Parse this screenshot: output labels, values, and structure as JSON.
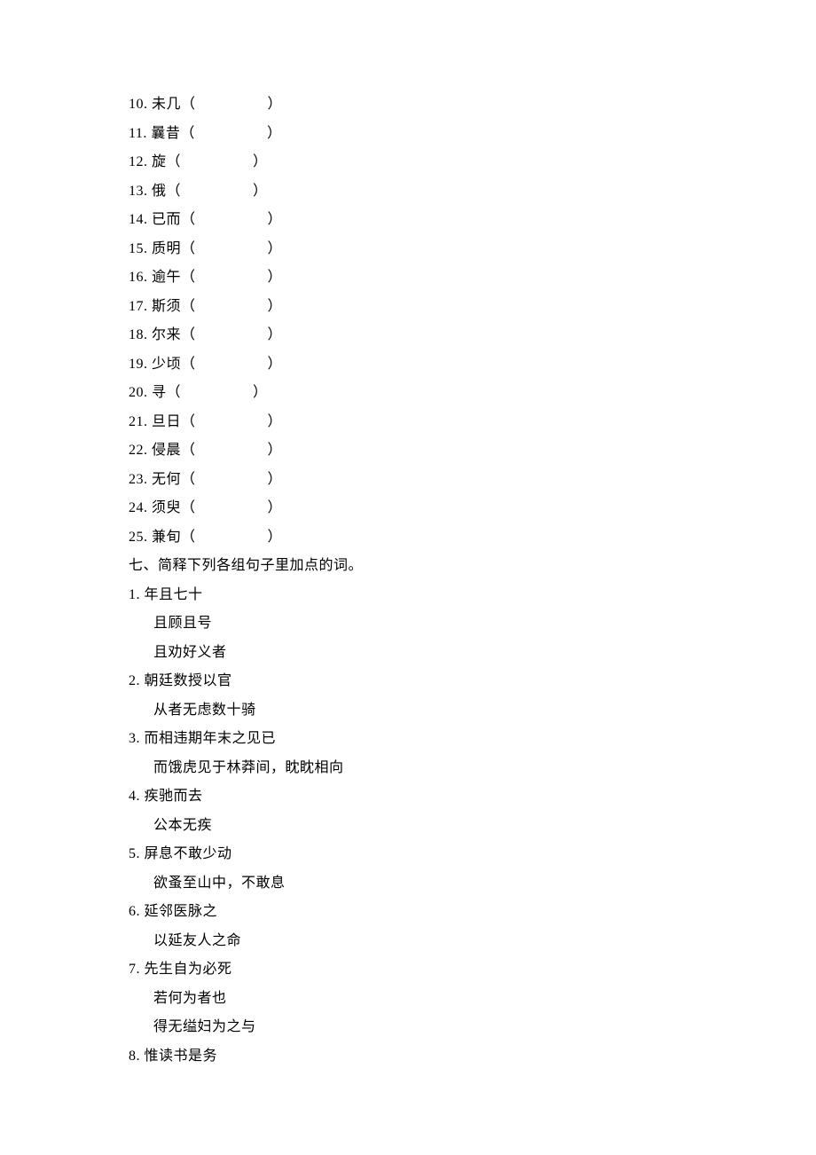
{
  "terms": [
    {
      "num": "10",
      "word": "未几",
      "gap": "                  "
    },
    {
      "num": "11",
      "word": "曩昔",
      "gap": "                  "
    },
    {
      "num": "12",
      "word": "旋",
      "gap": "                  "
    },
    {
      "num": "13",
      "word": "俄",
      "gap": "                  "
    },
    {
      "num": "14",
      "word": "已而",
      "gap": "                  "
    },
    {
      "num": "15",
      "word": "质明",
      "gap": "                  "
    },
    {
      "num": "16",
      "word": "逾午",
      "gap": "                  "
    },
    {
      "num": "17",
      "word": "斯须",
      "gap": "                  "
    },
    {
      "num": "18",
      "word": "尔来",
      "gap": "                  "
    },
    {
      "num": "19",
      "word": "少顷",
      "gap": "                  "
    },
    {
      "num": "20",
      "word": "寻",
      "gap": "                  "
    },
    {
      "num": "21",
      "word": "旦日",
      "gap": "                  "
    },
    {
      "num": "22",
      "word": "侵晨",
      "gap": "                  "
    },
    {
      "num": "23",
      "word": "无何",
      "gap": "                  "
    },
    {
      "num": "24",
      "word": "须臾",
      "gap": "                  "
    },
    {
      "num": "25",
      "word": "兼旬",
      "gap": "                  "
    }
  ],
  "section_title": "七、简释下列各组句子里加点的词。",
  "groups": [
    {
      "num": "1",
      "lines": [
        "年且七十",
        "且顾且号",
        "且劝好义者"
      ]
    },
    {
      "num": "2",
      "lines": [
        "朝廷数授以官",
        "从者无虑数十骑"
      ]
    },
    {
      "num": "3",
      "lines": [
        "而相违期年末之见已",
        "而饿虎见于林莽间，眈眈相向"
      ]
    },
    {
      "num": "4",
      "lines": [
        "疾驰而去",
        "公本无疾"
      ]
    },
    {
      "num": "5",
      "lines": [
        "屏息不敢少动",
        "欲蚤至山中，不敢息"
      ]
    },
    {
      "num": "6",
      "lines": [
        "延邻医脉之",
        "以延友人之命"
      ]
    },
    {
      "num": "7",
      "lines": [
        "先生自为必死",
        "若何为者也",
        "得无缢妇为之与"
      ]
    },
    {
      "num": "8",
      "lines": [
        "惟读书是务"
      ]
    }
  ]
}
